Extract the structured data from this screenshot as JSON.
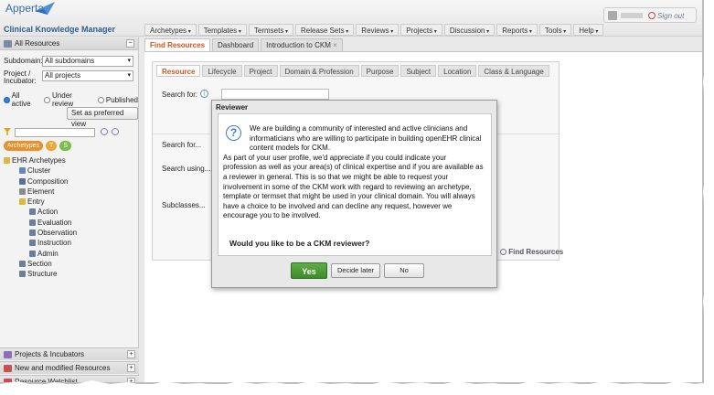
{
  "app": {
    "logo_text": "Apperta",
    "title": "Clinical Knowledge Manager"
  },
  "user": {
    "signout_label": "Sign out"
  },
  "menubar": [
    "Archetypes",
    "Templates",
    "Termsets",
    "Release Sets",
    "Reviews",
    "Projects",
    "Discussion",
    "Reports",
    "Tools",
    "Help"
  ],
  "left": {
    "header": "All Resources",
    "subdomain_label": "Subdomain:",
    "subdomain_value": "All subdomains",
    "project_label_1": "Project /",
    "project_label_2": "Incubator:",
    "project_value": "All projects",
    "radios": [
      "All active",
      "Under review",
      "Published"
    ],
    "pref_button": "Set as preferred view",
    "type_tabs": [
      "Archetypes",
      "T",
      "S"
    ],
    "tree": [
      {
        "label": "EHR Archetypes",
        "indent": 1,
        "icon": "folder-icon",
        "color": "#e0b540"
      },
      {
        "label": "Cluster",
        "indent": 2,
        "icon": "cluster-icon",
        "color": "#6a86b8"
      },
      {
        "label": "Composition",
        "indent": 2,
        "icon": "composition-icon",
        "color": "#5a6fa0"
      },
      {
        "label": "Element",
        "indent": 2,
        "icon": "element-icon",
        "color": "#8a8a8a"
      },
      {
        "label": "Entry",
        "indent": 2,
        "icon": "folder-icon",
        "color": "#e0b540"
      },
      {
        "label": "Action",
        "indent": 3,
        "icon": "action-icon",
        "color": "#6c7f9a"
      },
      {
        "label": "Evaluation",
        "indent": 3,
        "icon": "evaluation-icon",
        "color": "#6c7f9a"
      },
      {
        "label": "Observation",
        "indent": 3,
        "icon": "observation-icon",
        "color": "#6c7f9a"
      },
      {
        "label": "Instruction",
        "indent": 3,
        "icon": "instruction-icon",
        "color": "#6c7f9a"
      },
      {
        "label": "Admin",
        "indent": 3,
        "icon": "admin-icon",
        "color": "#6c7f9a"
      },
      {
        "label": "Section",
        "indent": 2,
        "icon": "section-icon",
        "color": "#6c7f9a"
      },
      {
        "label": "Structure",
        "indent": 2,
        "icon": "structure-icon",
        "color": "#6c7f9a"
      }
    ],
    "bottom": [
      {
        "label": "Projects & Incubators",
        "icon": "projects-icon",
        "color": "#8b6fb8"
      },
      {
        "label": "New and modified Resources",
        "icon": "calendar-icon",
        "color": "#c85050"
      },
      {
        "label": "Resource Watchlist",
        "icon": "heart-icon",
        "color": "#d04a4a"
      }
    ]
  },
  "tabs": [
    {
      "label": "Find Resources",
      "active": true
    },
    {
      "label": "Dashboard",
      "active": false
    },
    {
      "label": "Introduction to CKM",
      "active": false
    }
  ],
  "search": {
    "subtabs": [
      "Resource",
      "Lifecycle",
      "Project",
      "Domain & Profession",
      "Purpose",
      "Subject",
      "Location",
      "Class & Language"
    ],
    "search_for": "Search for:",
    "search_for_2": "Search for...",
    "search_using": "Search using...",
    "subclasses": "Subclasses...",
    "find_button": "Find Resources"
  },
  "modal": {
    "title": "Reviewer",
    "body_lines": [
      "We are building a community of interested and active clinicians and",
      "informaticians who are willing to participate in building openEHR clinical",
      "content models for CKM.",
      "As part of your user profile, we'd appreciate if you could indicate your",
      "profession as well as your area(s) of clinical expertise and if you are available as",
      "a reviewer in general. This is so that we might be able to request your",
      "involvement in some of the CKM work with regard to reviewing an archetype,",
      "template or termset that might be used in your clinical domain. You will always",
      "have a choice to be involved and can decline any request, however we",
      "encourage you to be involved."
    ],
    "question": "Would you like to be a CKM reviewer?",
    "yes_label": "Yes",
    "later_label": "Decide later",
    "no_label": "No"
  }
}
